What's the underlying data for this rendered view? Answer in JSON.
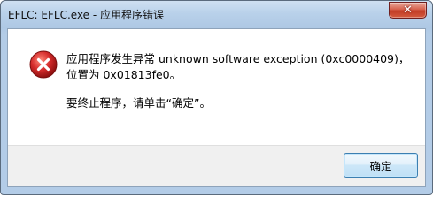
{
  "window": {
    "title": "EFLC: EFLC.exe - 应用程序错误",
    "close_glyph": "✕"
  },
  "message": {
    "line1": "应用程序发生异常 unknown software exception (0xc0000409)，位置为 0x01813fe0。",
    "line2": "要终止程序，请单击“确定”。"
  },
  "buttons": {
    "ok_label": "确定"
  },
  "icons": {
    "error": "error-icon"
  },
  "colors": {
    "error_red": "#d42b2b",
    "title_bar": "#b9d1ea",
    "footer_bg": "#f0f0f0"
  }
}
